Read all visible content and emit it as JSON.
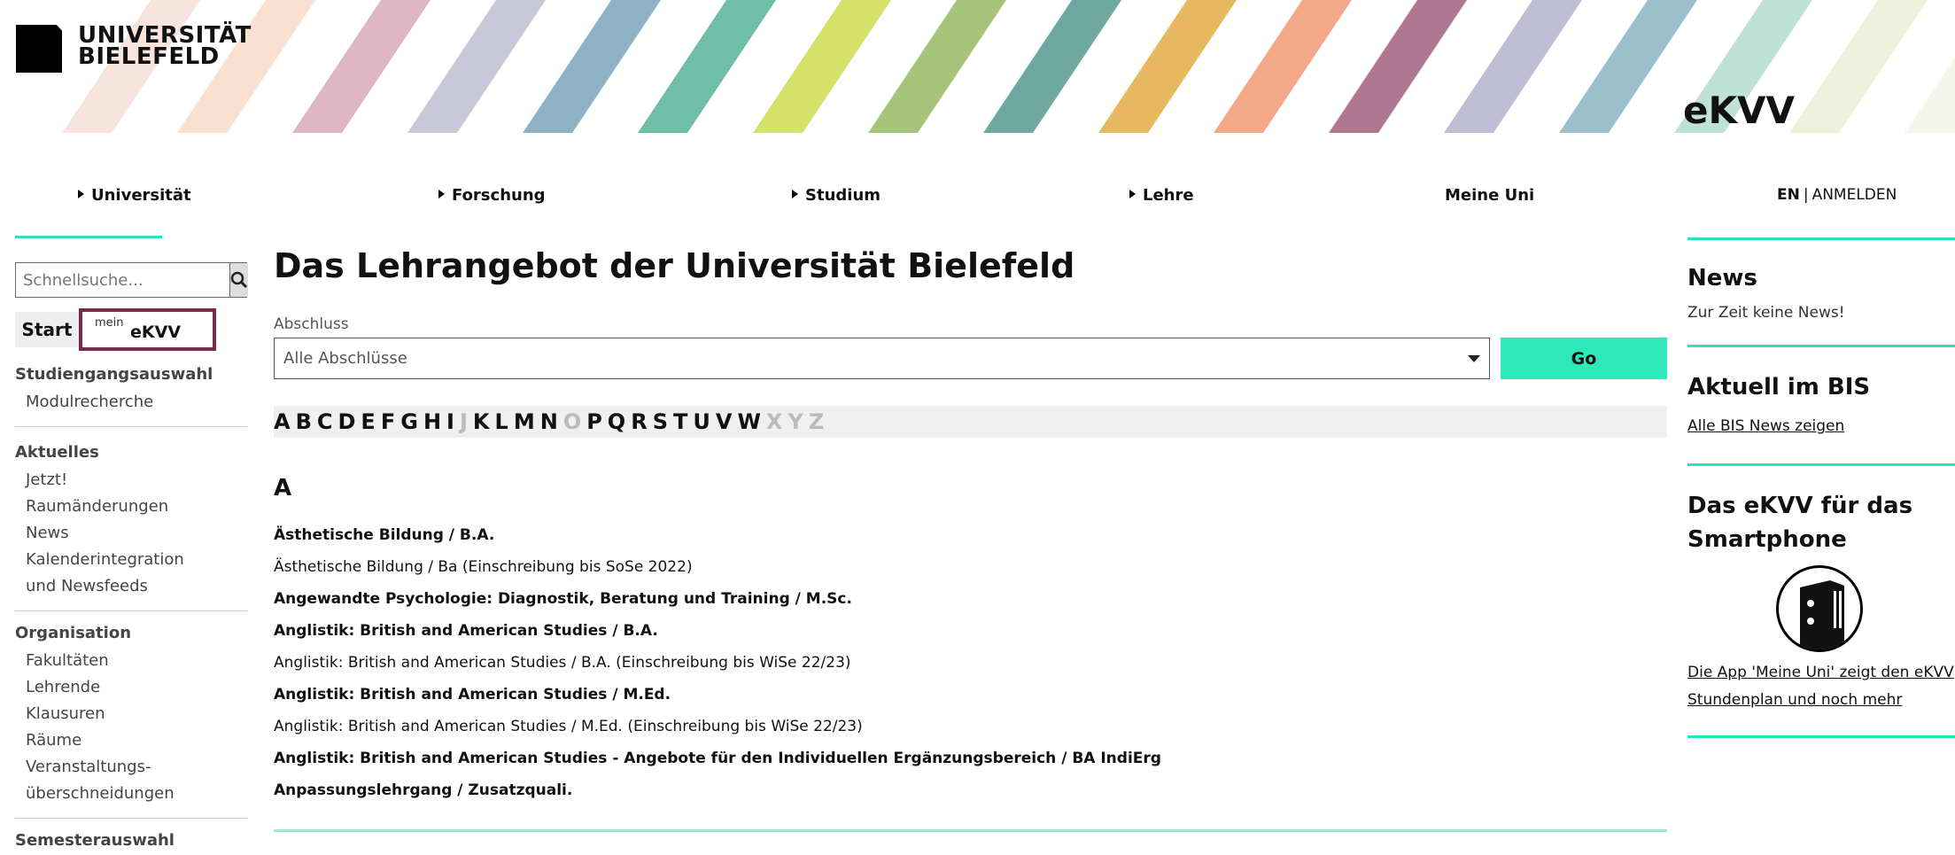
{
  "header": {
    "logo_line1": "UNIVERSITÄT",
    "logo_line2": "BIELEFELD",
    "site_title": "eKVV"
  },
  "topnav": {
    "items": [
      "Universität",
      "Forschung",
      "Studium",
      "Lehre",
      "Meine Uni"
    ],
    "lang": "EN",
    "login": "ANMELDEN"
  },
  "sidebar": {
    "search_placeholder": "Schnellsuche...",
    "tab_start": "Start",
    "tab_mein_sup": "mein",
    "tab_mein_main": "eKVV",
    "groups": [
      {
        "head": "Studiengangsauswahl",
        "links": [
          "Modulrecherche"
        ]
      },
      {
        "head": "Aktuelles",
        "links": [
          "Jetzt!",
          "Raumänderungen",
          "News",
          "Kalenderintegration",
          "und Newsfeeds"
        ]
      },
      {
        "head": "Organisation",
        "links": [
          "Fakultäten",
          "Lehrende",
          "Klausuren",
          "Räume",
          "Veranstaltungs-",
          "überschneidungen"
        ]
      },
      {
        "head": "Semesterauswahl",
        "links": []
      }
    ]
  },
  "main": {
    "title": "Das Lehrangebot der Universität Bielefeld",
    "abschluss_label": "Abschluss",
    "abschluss_value": "Alle Abschlüsse",
    "go_label": "Go",
    "alphabet": [
      "A",
      "B",
      "C",
      "D",
      "E",
      "F",
      "G",
      "H",
      "I",
      "J",
      "K",
      "L",
      "M",
      "N",
      "O",
      "P",
      "Q",
      "R",
      "S",
      "T",
      "U",
      "V",
      "W",
      "X",
      "Y",
      "Z"
    ],
    "alphabet_disabled": [
      "J",
      "O",
      "X",
      "Y",
      "Z"
    ],
    "letter": "A",
    "programs": [
      {
        "label": "Ästhetische Bildung / B.A.",
        "bold": true
      },
      {
        "label": "Ästhetische Bildung / Ba (Einschreibung bis SoSe 2022)",
        "bold": false
      },
      {
        "label": "Angewandte Psychologie: Diagnostik, Beratung und Training / M.Sc.",
        "bold": true
      },
      {
        "label": "Anglistik: British and American Studies / B.A.",
        "bold": true
      },
      {
        "label": "Anglistik: British and American Studies / B.A. (Einschreibung bis WiSe 22/23)",
        "bold": false
      },
      {
        "label": "Anglistik: British and American Studies / M.Ed.",
        "bold": true
      },
      {
        "label": "Anglistik: British and American Studies / M.Ed. (Einschreibung bis WiSe 22/23)",
        "bold": false
      },
      {
        "label": "Anglistik: British and American Studies - Angebote für den Individuellen Ergänzungsbereich / BA IndiErg",
        "bold": true
      },
      {
        "label": "Anpassungslehrgang / Zusatzquali.",
        "bold": true
      }
    ]
  },
  "right": {
    "news_head": "News",
    "news_text": "Zur Zeit keine News!",
    "bis_head": "Aktuell im BIS",
    "bis_link": "Alle BIS News zeigen",
    "app_head": "Das eKVV für das Smartphone",
    "app_link1": "Die App 'Meine Uni' zeigt den eKVV",
    "app_link2": "Stundenplan und noch mehr"
  },
  "colors": {
    "accent": "#2de0b8",
    "highlight_box": "#7a2a4e"
  }
}
